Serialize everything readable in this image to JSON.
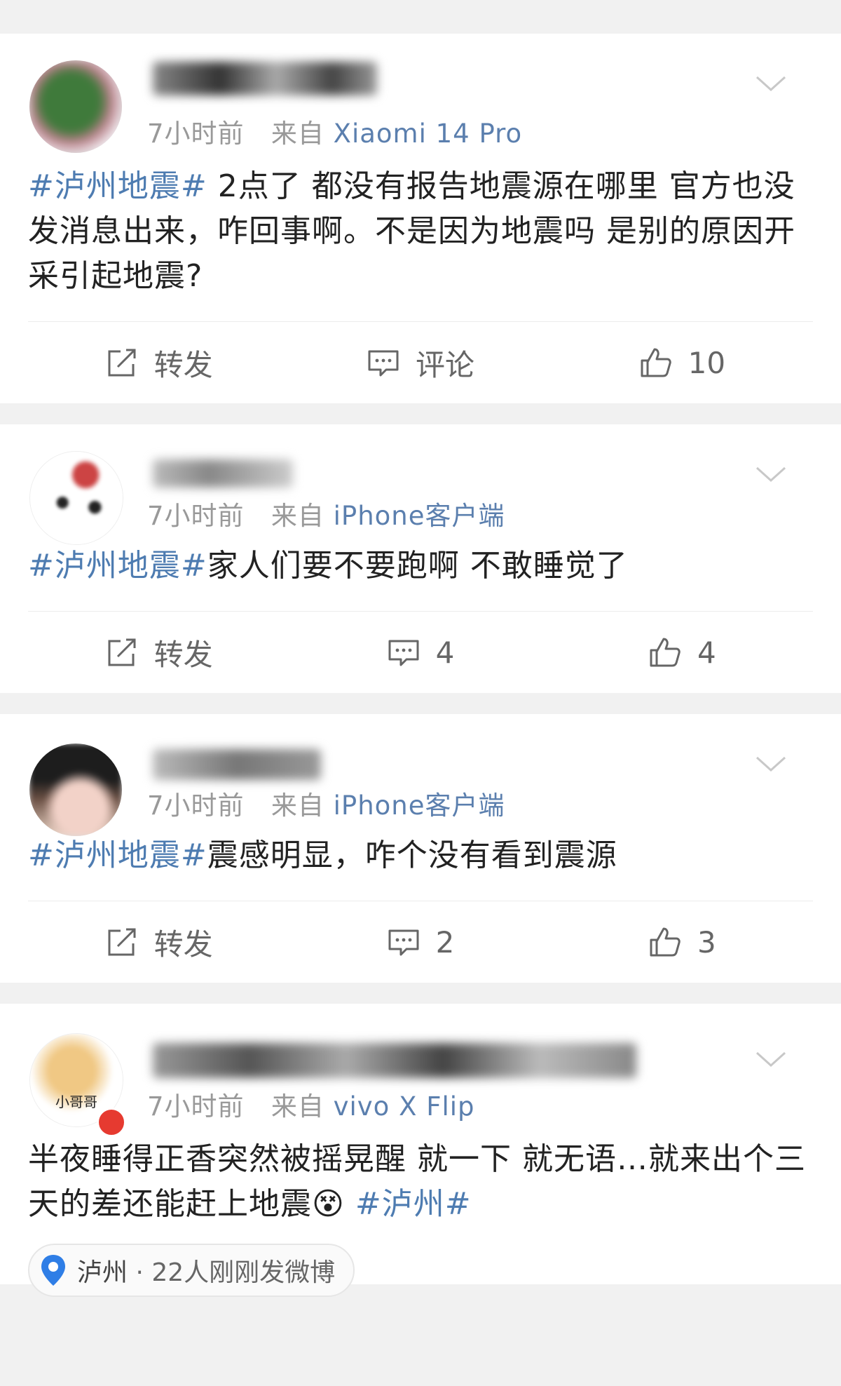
{
  "posts": [
    {
      "time": "7小时前",
      "from": "来自",
      "source": "Xiaomi 14 Pro",
      "hashtag": "#泸州地震#",
      "text": " 2点了 都没有报告地震源在哪里 官方也没发消息出来，咋回事啊。不是因为地震吗 是别的原因开采引起地震?",
      "repost": "转发",
      "comment": "评论",
      "likes": "10",
      "avatar_color": "#3d6e3a"
    },
    {
      "time": "7小时前",
      "from": "来自",
      "source": "iPhone客户端",
      "hashtag": "#泸州地震#",
      "text": "家人们要不要跑啊 不敢睡觉了",
      "repost": "转发",
      "comment": "4",
      "likes": "4",
      "avatar_color": "#ffffff"
    },
    {
      "time": "7小时前",
      "from": "来自",
      "source": "iPhone客户端",
      "hashtag": "#泸州地震#",
      "text": "震感明显，咋个没有看到震源",
      "repost": "转发",
      "comment": "2",
      "likes": "3",
      "avatar_color": "#2c2c2c"
    },
    {
      "time": "7小时前",
      "from": "来自",
      "source": "vivo X Flip",
      "text": "半夜睡得正香突然被摇晃醒 就一下 就无语…就来出个三天的差还能赶上地震",
      "emoji": "😵",
      "hashtag": "#泸州#",
      "location": "泸州",
      "location_extra": "· 22人刚刚发微博",
      "avatar_text": "小哥哥",
      "avatar_color": "#f3d9a0"
    }
  ],
  "colors": {
    "link": "#4e7cb1",
    "meta": "#999999",
    "text": "#222222",
    "bg": "#f1f1f1"
  }
}
